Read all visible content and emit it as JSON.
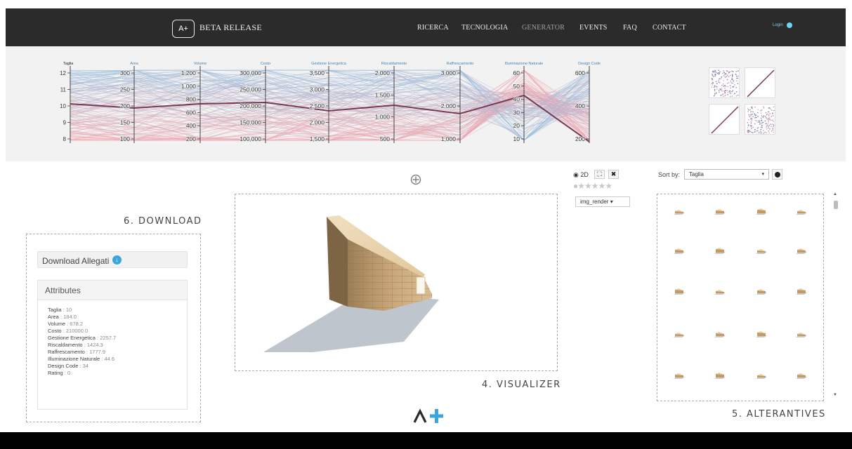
{
  "nav": {
    "logo": "A+",
    "brand": "BETA RELEASE",
    "items": [
      {
        "label": "RICERCA",
        "active": false
      },
      {
        "label": "TECNOLOGIA",
        "active": false
      },
      {
        "label": "GENERATOR",
        "active": true
      },
      {
        "label": "EVENTS",
        "active": false
      },
      {
        "label": "FAQ",
        "active": false
      },
      {
        "label": "CONTACT",
        "active": false
      }
    ],
    "login": "Login"
  },
  "parallel_coordinates": {
    "axes": [
      {
        "name": "Taglia",
        "ticks": [
          "12",
          "11",
          "10",
          "9",
          "8"
        ]
      },
      {
        "name": "Area",
        "ticks": [
          "300",
          "250",
          "200",
          "150",
          "100"
        ]
      },
      {
        "name": "Volume",
        "ticks": [
          "1,200",
          "1,000",
          "800",
          "600",
          "400",
          "200"
        ]
      },
      {
        "name": "Costo",
        "ticks": [
          "300,000",
          "250,000",
          "200,000",
          "150,000",
          "100,000"
        ]
      },
      {
        "name": "Gestione Energetica",
        "ticks": [
          "3,500",
          "3,000",
          "2,500",
          "2,000",
          "1,500"
        ]
      },
      {
        "name": "Riscaldamento",
        "ticks": [
          "2,000",
          "1,500",
          "1,000",
          "500"
        ]
      },
      {
        "name": "Raffrescamento",
        "ticks": [
          "3,000",
          "2,000",
          "1,000"
        ]
      },
      {
        "name": "Illuminazione Naturale",
        "ticks": [
          "60",
          "50",
          "40",
          "30",
          "20",
          "10"
        ]
      },
      {
        "name": "Design Code",
        "ticks": [
          "600",
          "400",
          "200"
        ]
      }
    ],
    "colors": {
      "low": "#f7a1a8",
      "high": "#93bfe2",
      "selected": "#7a3a55"
    }
  },
  "download": {
    "title": "6. DOWNLOAD",
    "button_label": "Download Allegati",
    "attributes_title": "Attributes",
    "attributes": [
      {
        "key": "Taglia",
        "value": "10"
      },
      {
        "key": "Area",
        "value": "184.0"
      },
      {
        "key": "Volume",
        "value": "678.2"
      },
      {
        "key": "Costo",
        "value": "210000.0"
      },
      {
        "key": "Gestione Energetica",
        "value": "2257.7"
      },
      {
        "key": "Riscaldamento",
        "value": "1424.3"
      },
      {
        "key": "Raffrescamento",
        "value": "1777.9"
      },
      {
        "key": "Illuminazione Naturale",
        "value": "44.6"
      },
      {
        "key": "Design Code",
        "value": "34"
      },
      {
        "key": "Rating",
        "value": "0"
      }
    ]
  },
  "visualizer": {
    "title": "4. VISUALIZER",
    "mode_label": "2D",
    "rating_stars": 5,
    "render_select": "img_render"
  },
  "alternatives": {
    "title": "5. ALTERANTIVES",
    "sort_label": "Sort by:",
    "sort_value": "Taglia",
    "count": 20
  }
}
